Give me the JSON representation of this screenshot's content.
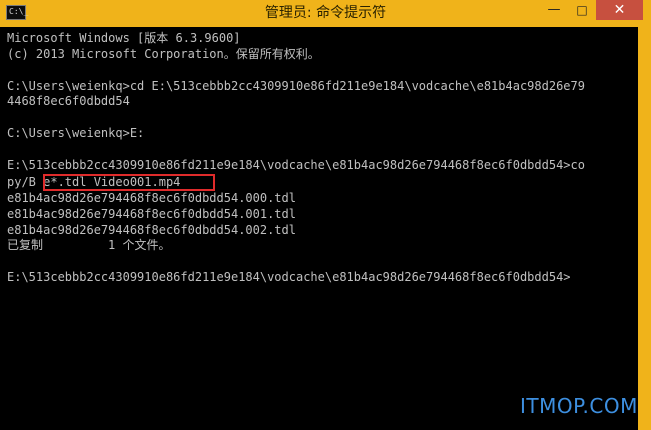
{
  "window": {
    "title": "管理员: 命令提示符",
    "icon_label": "C:\\_",
    "controls": {
      "minimize": "—",
      "maximize": "□",
      "close": "✕"
    }
  },
  "console": {
    "lines": [
      "Microsoft Windows [版本 6.3.9600]",
      "(c) 2013 Microsoft Corporation。保留所有权利。",
      "",
      "C:\\Users\\weienkq>cd E:\\513cebbb2cc4309910e86fd211e9e184\\vodcache\\e81b4ac98d26e79",
      "4468f8ec6f0dbdd54",
      "",
      "C:\\Users\\weienkq>E:",
      "",
      "E:\\513cebbb2cc4309910e86fd211e9e184\\vodcache\\e81b4ac98d26e794468f8ec6f0dbdd54>co",
      "py/B e*.tdl Video001.mp4",
      "e81b4ac98d26e794468f8ec6f0dbdd54.000.tdl",
      "e81b4ac98d26e794468f8ec6f0dbdd54.001.tdl",
      "e81b4ac98d26e794468f8ec6f0dbdd54.002.tdl",
      "已复制         1 个文件。",
      "",
      "E:\\513cebbb2cc4309910e86fd211e9e184\\vodcache\\e81b4ac98d26e794468f8ec6f0dbdd54>"
    ]
  },
  "watermark": "ITMOP.COM",
  "colors": {
    "titlebar": "#f0b31a",
    "console_bg": "#000000",
    "console_text": "#c0c0c0",
    "highlight": "#e02b2b",
    "watermark": "#3d8fe0"
  }
}
